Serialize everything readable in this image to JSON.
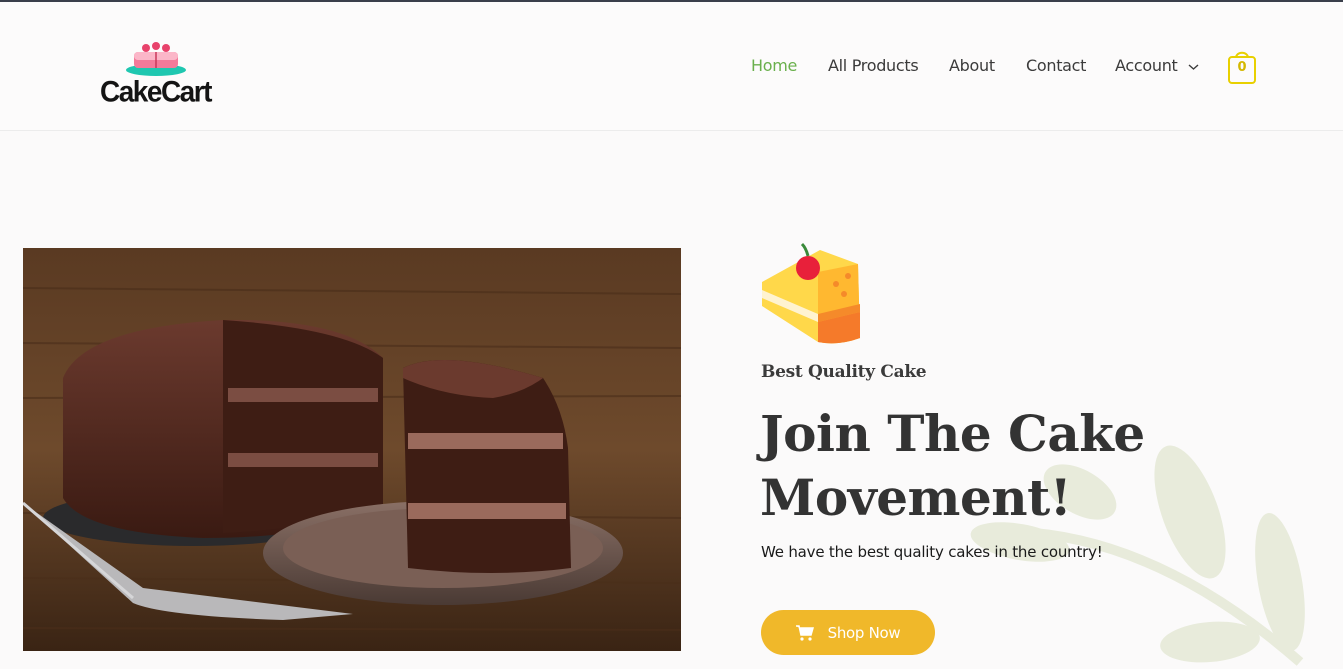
{
  "brand": {
    "name": "CakeCart"
  },
  "nav": {
    "items": [
      {
        "label": "Home",
        "active": true
      },
      {
        "label": "All Products",
        "active": false
      },
      {
        "label": "About",
        "active": false
      },
      {
        "label": "Contact",
        "active": false
      },
      {
        "label": "Account",
        "active": false,
        "has_dropdown": true
      }
    ]
  },
  "cart": {
    "count": "0",
    "icon": "shopping-bag-icon"
  },
  "hero": {
    "eyebrow": "Best Quality Cake",
    "headline": "Join The Cake Movement!",
    "subtext": "We have the best quality cakes in the country!",
    "cta_label": "Shop Now",
    "cta_icon": "shopping-cart-icon"
  },
  "colors": {
    "accent_green": "#6ab04c",
    "button_yellow": "#f0b82a",
    "cart_yellow": "#e8d000",
    "text_dark": "#333333"
  }
}
